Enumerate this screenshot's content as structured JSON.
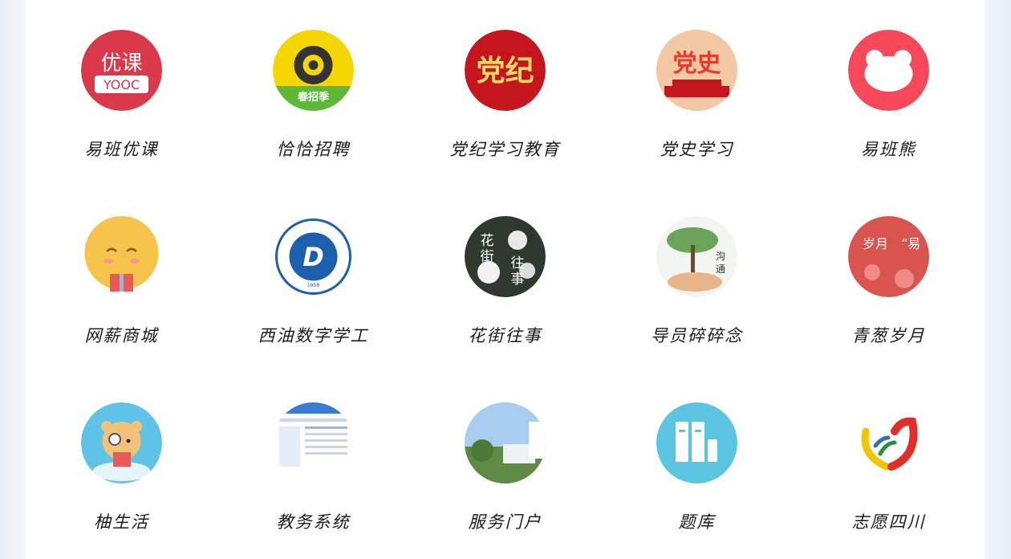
{
  "apps": [
    {
      "label": "易班优课",
      "icon": "yooc-icon",
      "icon_text": [
        "优课",
        "YOOC"
      ],
      "color": "#d9394a"
    },
    {
      "label": "恰恰招聘",
      "icon": "spring-recruit-icon",
      "icon_text": [
        "春招季"
      ],
      "color": "#f5d600"
    },
    {
      "label": "党纪学习教育",
      "icon": "party-discipline-icon",
      "icon_text": [
        "党纪"
      ],
      "color": "#c4161c"
    },
    {
      "label": "党史学习",
      "icon": "party-history-icon",
      "icon_text": [
        "党史"
      ],
      "color": "#e83a2f"
    },
    {
      "label": "易班熊",
      "icon": "yiban-bear-icon",
      "icon_text": [],
      "color": "#f5495a"
    },
    {
      "label": "网薪商城",
      "icon": "gift-chick-icon",
      "icon_text": [],
      "color": "#f6c44a"
    },
    {
      "label": "西油数字学工",
      "icon": "swpu-logo-icon",
      "icon_text": [
        "SOUTHWEST PETROLEUM UNIVERSITY",
        "1958"
      ],
      "color": "#1c5fae"
    },
    {
      "label": "花街往事",
      "icon": "flower-street-icon",
      "icon_text": [
        "花街",
        "往事"
      ],
      "color": "#3b3b3b"
    },
    {
      "label": "导员碎碎念",
      "icon": "tree-hands-icon",
      "icon_text": [
        "沟通"
      ],
      "color": "#6aa35a"
    },
    {
      "label": "青葱岁月",
      "icon": "green-years-icon",
      "icon_text": [
        "岁月",
        "易"
      ],
      "color": "#d9534f"
    },
    {
      "label": "柚生活",
      "icon": "bear-mascot-icon",
      "icon_text": [],
      "color": "#5ec3e6"
    },
    {
      "label": "教务系统",
      "icon": "academic-system-icon",
      "icon_text": [],
      "color": "#3a7bd5"
    },
    {
      "label": "服务门户",
      "icon": "service-portal-icon",
      "icon_text": [],
      "color": "#6fa8dc"
    },
    {
      "label": "题库",
      "icon": "question-bank-icon",
      "icon_text": [],
      "color": "#5bc4e0"
    },
    {
      "label": "志愿四川",
      "icon": "volunteer-sichuan-icon",
      "icon_text": [],
      "color": "#e52d27"
    }
  ]
}
